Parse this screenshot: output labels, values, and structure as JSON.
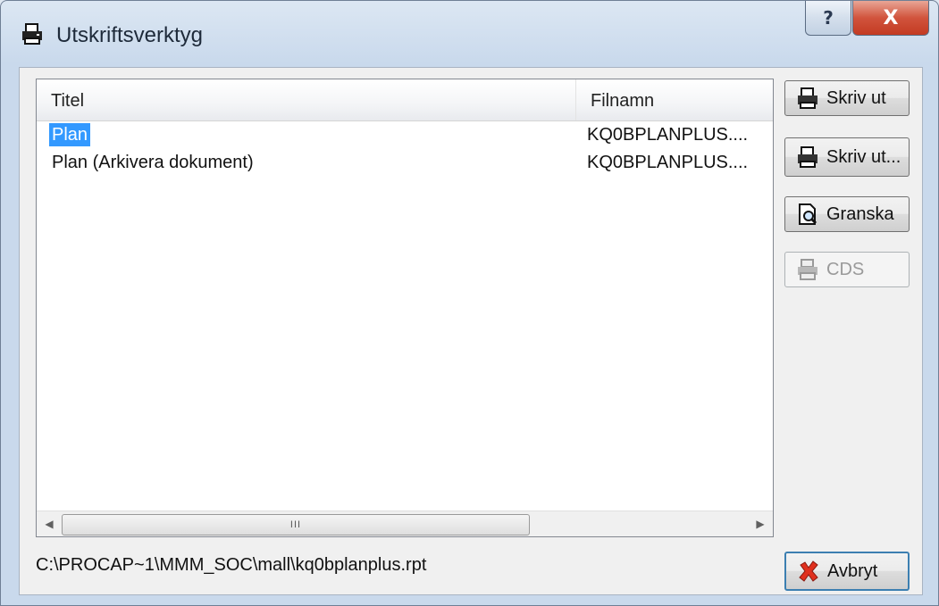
{
  "window": {
    "title": "Utskriftsverktyg",
    "help_label": "?",
    "close_label": "X"
  },
  "list": {
    "columns": [
      "Titel",
      "Filnamn"
    ],
    "rows": [
      {
        "title": "Plan",
        "file": "KQ0BPLANPLUS....",
        "selected": true
      },
      {
        "title": "Plan (Arkivera dokument)",
        "file": "KQ0BPLANPLUS....",
        "selected": false
      }
    ],
    "scroll_thumb_glyph": "III",
    "scroll_left_glyph": "◀",
    "scroll_right_glyph": "▶"
  },
  "buttons": {
    "print": {
      "label": "Skriv ut",
      "icon": "printer-icon"
    },
    "print_dialog": {
      "label": "Skriv ut...",
      "icon": "printer-icon"
    },
    "preview": {
      "label": "Granska",
      "icon": "preview-icon"
    },
    "cds": {
      "label": "CDS",
      "icon": "cds-icon",
      "enabled": false
    },
    "cancel": {
      "label": "Avbryt",
      "icon": "cancel-x-icon"
    }
  },
  "status": {
    "path": "C:\\PROCAP~1\\MMM_SOC\\mall\\kq0bplanplus.rpt"
  }
}
